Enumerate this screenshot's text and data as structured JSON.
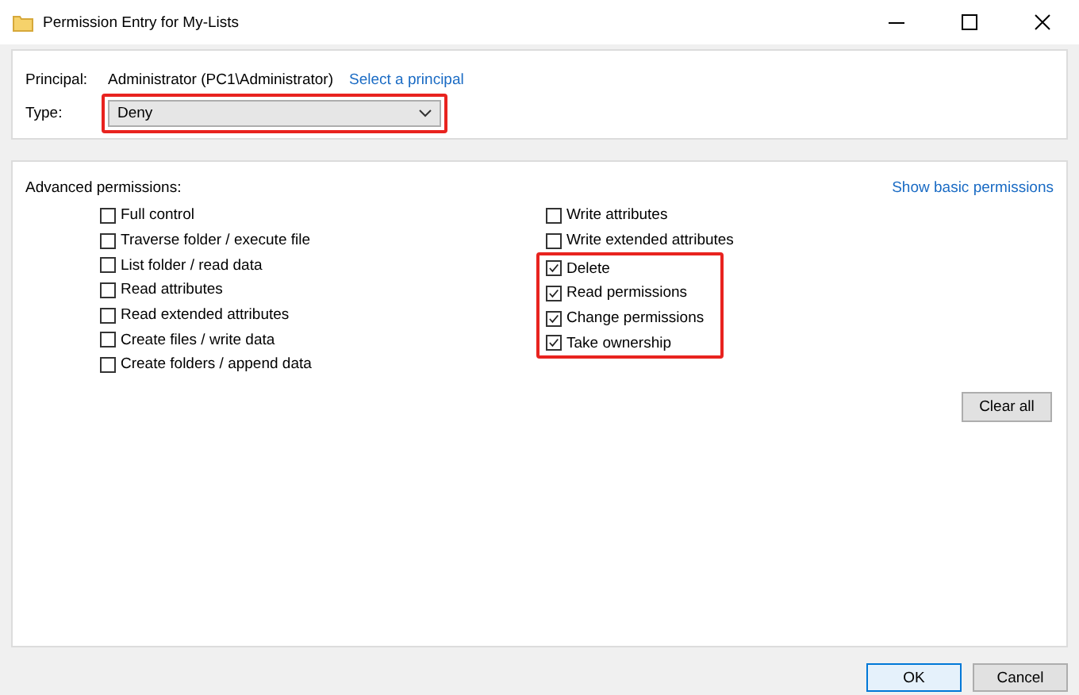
{
  "window": {
    "title": "Permission Entry for My-Lists"
  },
  "principal": {
    "label": "Principal:",
    "value": "Administrator (PC1\\Administrator)",
    "link": "Select a principal"
  },
  "type": {
    "label": "Type:",
    "value": "Deny",
    "highlighted": true
  },
  "advanced": {
    "heading": "Advanced permissions:",
    "link": "Show basic permissions",
    "columns": [
      [
        {
          "label": "Full control",
          "checked": false,
          "highlighted": false
        },
        {
          "label": "Traverse folder / execute file",
          "checked": false,
          "highlighted": false
        },
        {
          "label": "List folder / read data",
          "checked": false,
          "highlighted": false
        },
        {
          "label": "Read attributes",
          "checked": false,
          "highlighted": false
        },
        {
          "label": "Read extended attributes",
          "checked": false,
          "highlighted": false
        },
        {
          "label": "Create files / write data",
          "checked": false,
          "highlighted": false
        },
        {
          "label": "Create folders / append data",
          "checked": false,
          "highlighted": false
        }
      ],
      [
        {
          "label": "Write attributes",
          "checked": false,
          "highlighted": false
        },
        {
          "label": "Write extended attributes",
          "checked": false,
          "highlighted": false
        },
        {
          "label": "Delete",
          "checked": true,
          "highlighted": true
        },
        {
          "label": "Read permissions",
          "checked": true,
          "highlighted": true
        },
        {
          "label": "Change permissions",
          "checked": true,
          "highlighted": true
        },
        {
          "label": "Take ownership",
          "checked": true,
          "highlighted": true
        }
      ]
    ],
    "clear_button": "Clear all"
  },
  "buttons": [
    {
      "label": "OK",
      "default": true
    },
    {
      "label": "Cancel",
      "default": false
    }
  ]
}
